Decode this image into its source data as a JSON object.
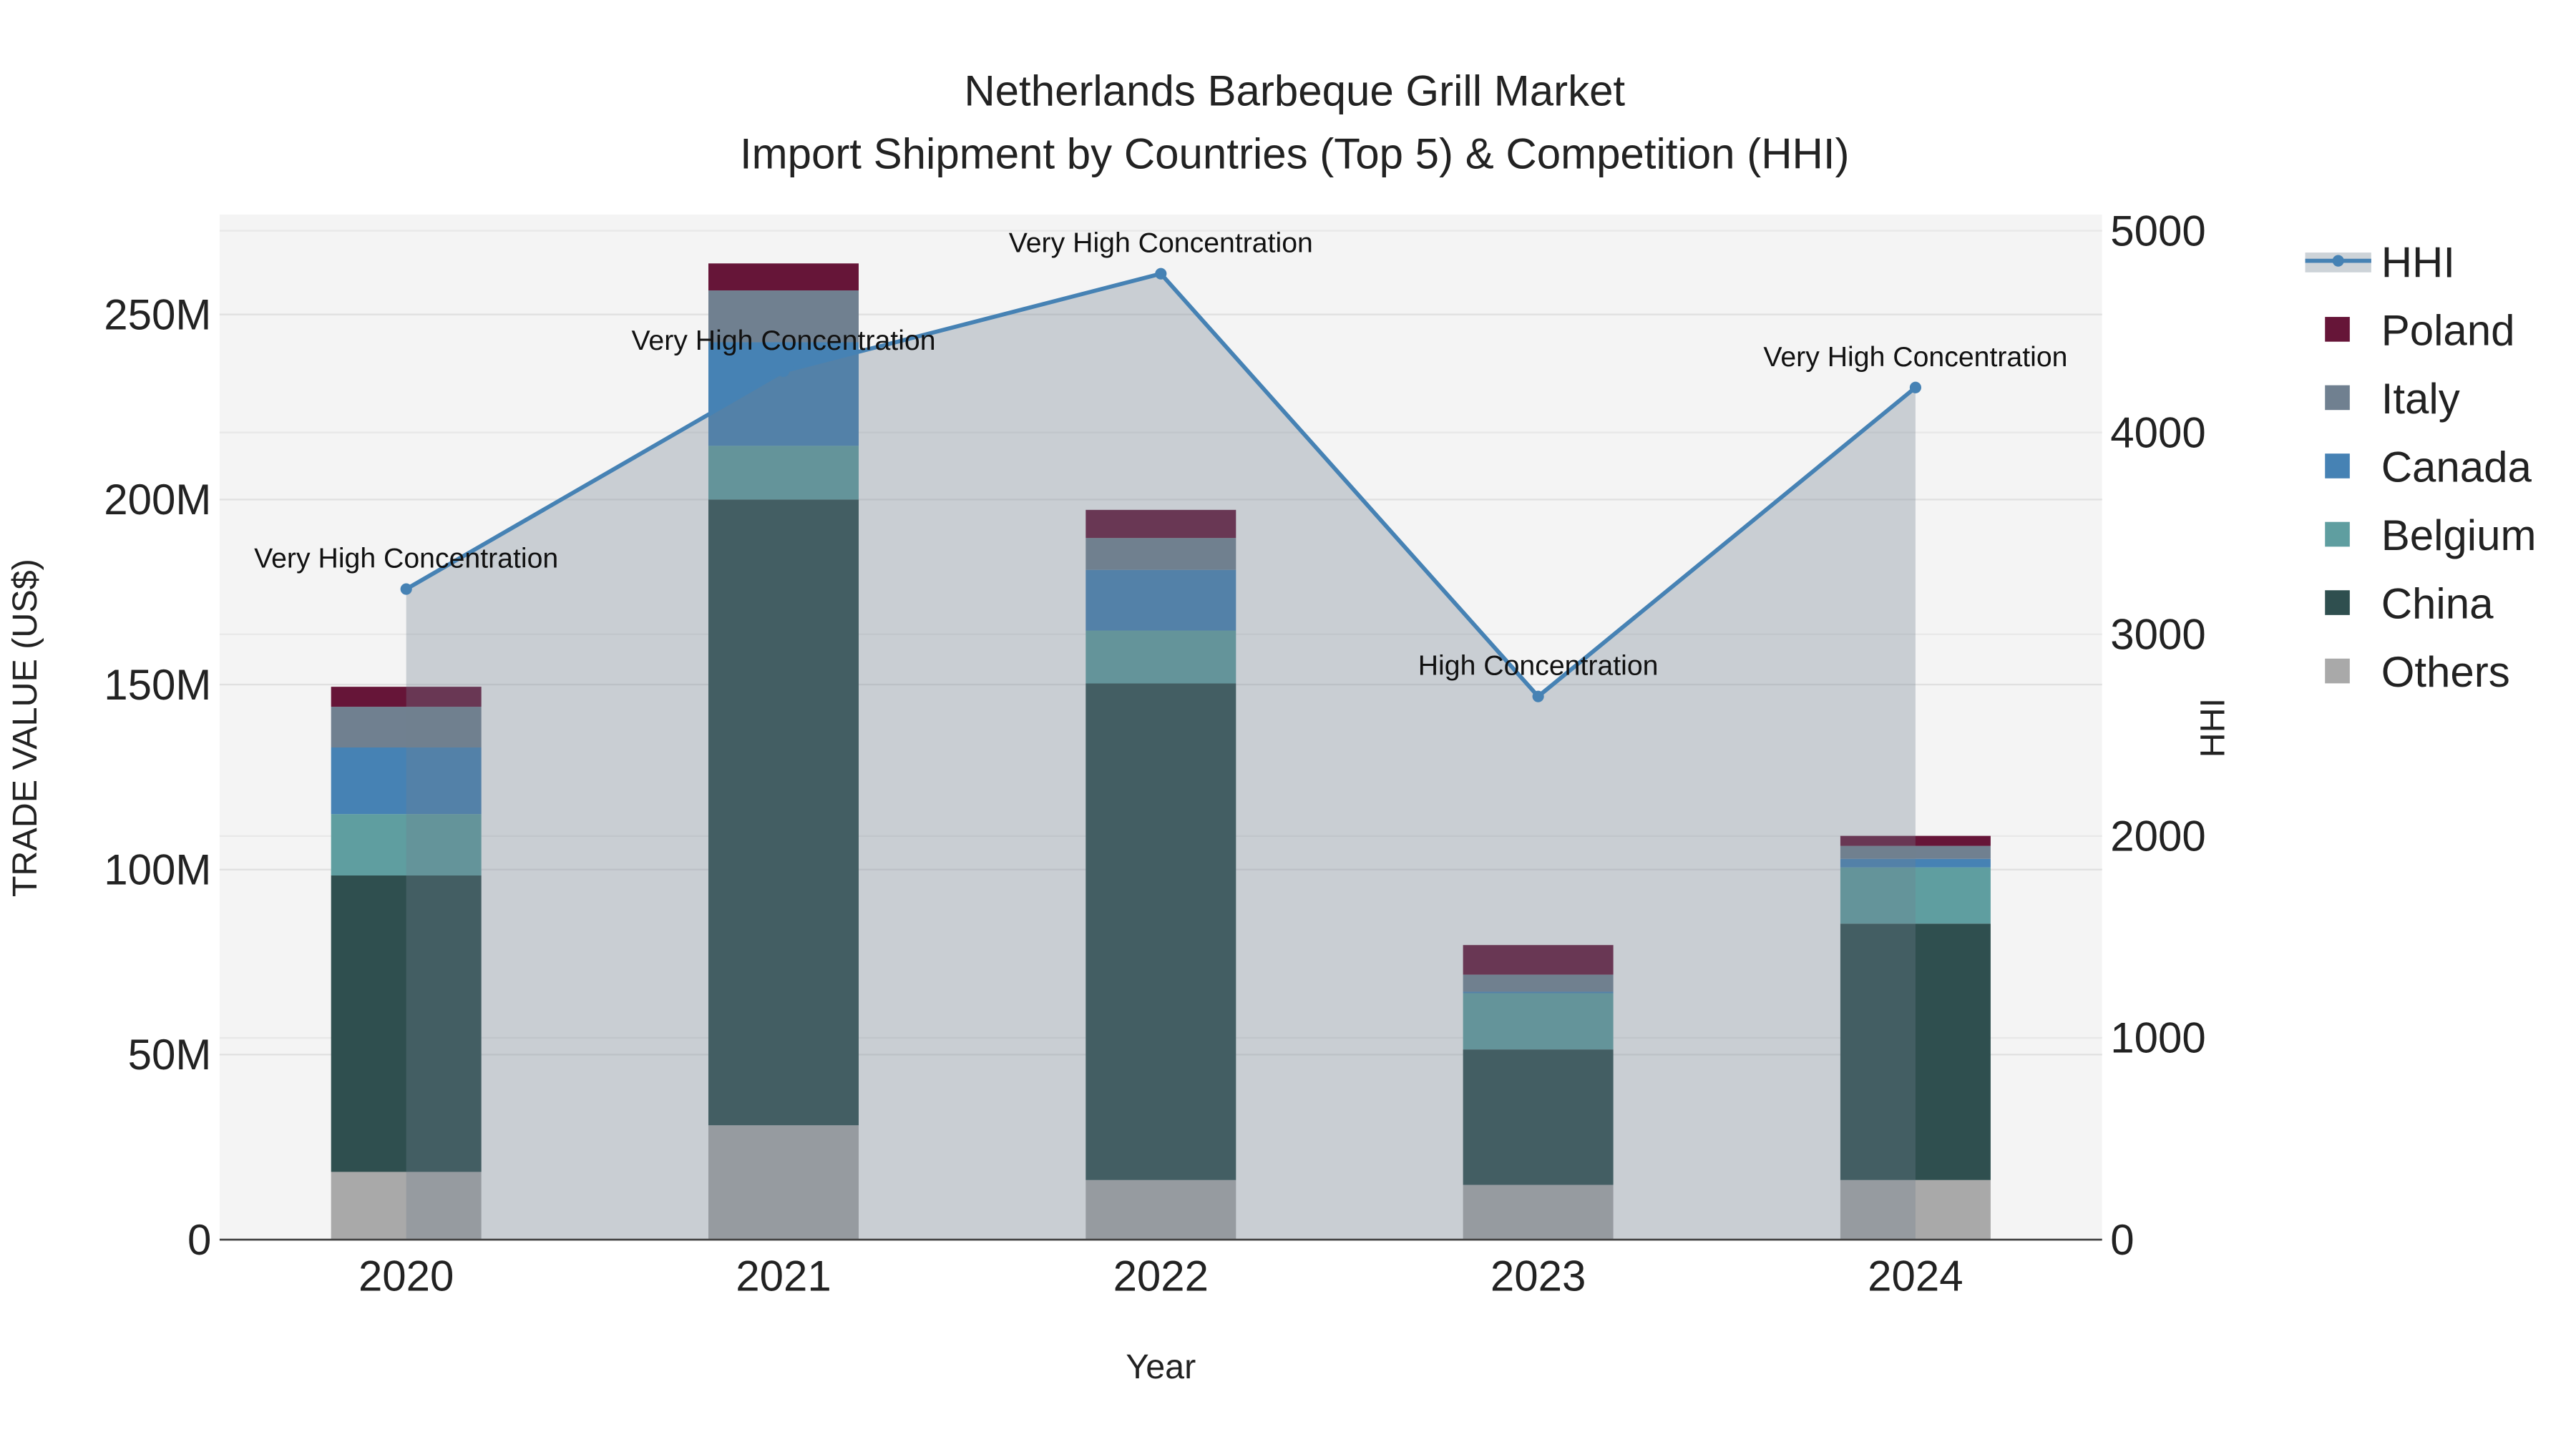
{
  "chart_data": {
    "type": "bar",
    "title": "Netherlands Barbeque Grill Market",
    "subtitle": "Import Shipment by Countries (Top 5) & Competition (HHI)",
    "xlabel": "Year",
    "ylabel": "TRADE VALUE (US$)",
    "y2label": "HHI",
    "categories": [
      "2020",
      "2021",
      "2022",
      "2023",
      "2024"
    ],
    "ylim": [
      0,
      277000000
    ],
    "y2lim": [
      0,
      5080
    ],
    "yticks": [
      {
        "v": 0,
        "label": "0"
      },
      {
        "v": 50000000,
        "label": "50M"
      },
      {
        "v": 100000000,
        "label": "100M"
      },
      {
        "v": 150000000,
        "label": "150M"
      },
      {
        "v": 200000000,
        "label": "200M"
      },
      {
        "v": 250000000,
        "label": "250M"
      }
    ],
    "y2ticks": [
      {
        "v": 0,
        "label": "0"
      },
      {
        "v": 1000,
        "label": "1000"
      },
      {
        "v": 2000,
        "label": "2000"
      },
      {
        "v": 3000,
        "label": "3000"
      },
      {
        "v": 4000,
        "label": "4000"
      },
      {
        "v": 5000,
        "label": "5000"
      }
    ],
    "grid": true,
    "legend_position": "right",
    "series": [
      {
        "name": "Others",
        "color": "#a9a9a9",
        "values": [
          18300000,
          30900000,
          16100000,
          14800000,
          16100000
        ]
      },
      {
        "name": "China",
        "color": "#2f4f4f",
        "values": [
          80100000,
          169100000,
          134200000,
          36600000,
          69300000
        ]
      },
      {
        "name": "Belgium",
        "color": "#5f9ea0",
        "values": [
          16600000,
          14500000,
          14300000,
          15200000,
          15200000
        ]
      },
      {
        "name": "Canada",
        "color": "#4682b4",
        "values": [
          18000000,
          28000000,
          16400000,
          400000,
          2300000
        ]
      },
      {
        "name": "Italy",
        "color": "#708090",
        "values": [
          11000000,
          14000000,
          8600000,
          4600000,
          3500000
        ]
      },
      {
        "name": "Poland",
        "color": "#661538",
        "values": [
          5400000,
          7300000,
          7600000,
          8000000,
          2700000
        ]
      }
    ],
    "hhi": {
      "name": "HHI",
      "color": "#4682b4",
      "values": [
        3224,
        4304,
        4787,
        2692,
        4223
      ],
      "annotations": [
        "Very High Concentration",
        "Very High Concentration",
        "Very High Concentration",
        "High Concentration",
        "Very High Concentration"
      ]
    }
  }
}
